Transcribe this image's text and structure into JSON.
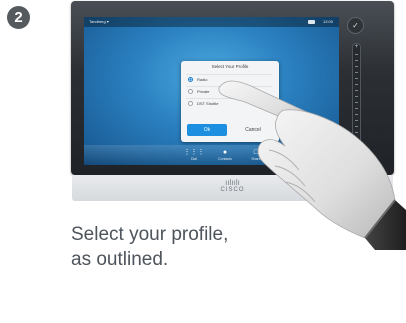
{
  "step": {
    "number": "2"
  },
  "screen": {
    "statusbar": {
      "left_text": "Tandberg ▾",
      "time": "12:00"
    },
    "dialog": {
      "title": "Select Your Profile",
      "options": [
        {
          "label": "Radio",
          "selected": true
        },
        {
          "label": "Private",
          "selected": false
        },
        {
          "label": "DST Shuttle",
          "selected": false
        }
      ],
      "ok_label": "Ok",
      "cancel_label": "Cancel"
    },
    "bottombar": {
      "items": [
        {
          "label": "Dial",
          "icon": "grid-icon"
        },
        {
          "label": "Contacts",
          "icon": "person-icon"
        },
        {
          "label": "Share",
          "icon": "share-icon"
        }
      ]
    }
  },
  "device": {
    "brand": "CISCO"
  },
  "caption": {
    "line1": "Select your profile,",
    "line2": "as outlined."
  },
  "colors": {
    "screen_blue": "#2a7fbf",
    "ok_button": "#1d8fe0",
    "badge": "#555a5f"
  }
}
